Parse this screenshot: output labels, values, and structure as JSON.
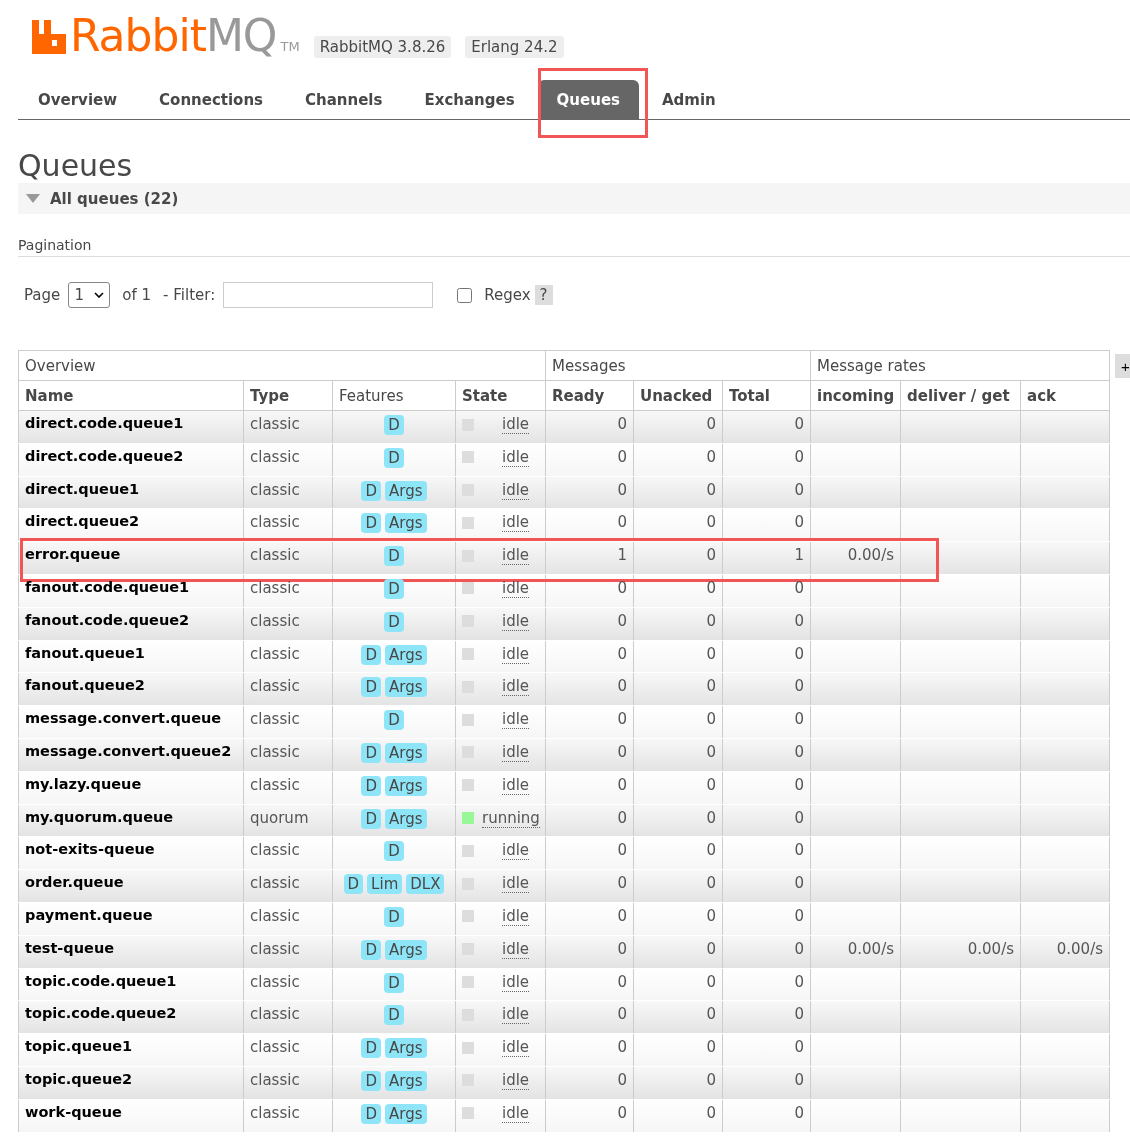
{
  "header": {
    "logo": {
      "brand": "Rabbit",
      "suffix": "MQ",
      "mark": "TM"
    },
    "versions": [
      "RabbitMQ 3.8.26",
      "Erlang 24.2"
    ]
  },
  "tabs": [
    {
      "label": "Overview",
      "selected": false,
      "highlighted": false
    },
    {
      "label": "Connections",
      "selected": false,
      "highlighted": false
    },
    {
      "label": "Channels",
      "selected": false,
      "highlighted": false
    },
    {
      "label": "Exchanges",
      "selected": false,
      "highlighted": false
    },
    {
      "label": "Queues",
      "selected": true,
      "highlighted": true
    },
    {
      "label": "Admin",
      "selected": false,
      "highlighted": false
    }
  ],
  "page_title": "Queues",
  "section": {
    "title": "All queues (22)",
    "expanded": true
  },
  "pagination": {
    "title": "Pagination",
    "page_label": "Page",
    "page": "1",
    "of": "of 1",
    "filter_label": "- Filter:",
    "regex": {
      "label": "Regex",
      "checked": false
    },
    "help": "?"
  },
  "table": {
    "groups": [
      "Overview",
      "Messages",
      "Message rates"
    ],
    "add_button": "+",
    "columns": [
      "Name",
      "Type",
      "Features",
      "State",
      "Ready",
      "Unacked",
      "Total",
      "incoming",
      "deliver / get",
      "ack"
    ],
    "rows": [
      {
        "name": "direct.code.queue1",
        "type": "classic",
        "features": [
          "D"
        ],
        "state": "idle",
        "color": "#dddddd",
        "ready": "0",
        "unacked": "0",
        "total": "0",
        "highlighted": false
      },
      {
        "name": "direct.code.queue2",
        "type": "classic",
        "features": [
          "D"
        ],
        "state": "idle",
        "color": "#dddddd",
        "ready": "0",
        "unacked": "0",
        "total": "0",
        "highlighted": false
      },
      {
        "name": "direct.queue1",
        "type": "classic",
        "features": [
          "D",
          "Args"
        ],
        "state": "idle",
        "color": "#dddddd",
        "ready": "0",
        "unacked": "0",
        "total": "0",
        "highlighted": false
      },
      {
        "name": "direct.queue2",
        "type": "classic",
        "features": [
          "D",
          "Args"
        ],
        "state": "idle",
        "color": "#dddddd",
        "ready": "0",
        "unacked": "0",
        "total": "0",
        "highlighted": false
      },
      {
        "name": "error.queue",
        "type": "classic",
        "features": [
          "D"
        ],
        "state": "idle",
        "color": "#dddddd",
        "ready": "1",
        "unacked": "0",
        "total": "1",
        "incoming": "0.00/s",
        "highlighted": true
      },
      {
        "name": "fanout.code.queue1",
        "type": "classic",
        "features": [
          "D"
        ],
        "state": "idle",
        "color": "#dddddd",
        "ready": "0",
        "unacked": "0",
        "total": "0",
        "highlighted": false
      },
      {
        "name": "fanout.code.queue2",
        "type": "classic",
        "features": [
          "D"
        ],
        "state": "idle",
        "color": "#dddddd",
        "ready": "0",
        "unacked": "0",
        "total": "0",
        "highlighted": false
      },
      {
        "name": "fanout.queue1",
        "type": "classic",
        "features": [
          "D",
          "Args"
        ],
        "state": "idle",
        "color": "#dddddd",
        "ready": "0",
        "unacked": "0",
        "total": "0",
        "highlighted": false
      },
      {
        "name": "fanout.queue2",
        "type": "classic",
        "features": [
          "D",
          "Args"
        ],
        "state": "idle",
        "color": "#dddddd",
        "ready": "0",
        "unacked": "0",
        "total": "0",
        "highlighted": false
      },
      {
        "name": "message.convert.queue",
        "type": "classic",
        "features": [
          "D"
        ],
        "state": "idle",
        "color": "#dddddd",
        "ready": "0",
        "unacked": "0",
        "total": "0",
        "highlighted": false
      },
      {
        "name": "message.convert.queue2",
        "type": "classic",
        "features": [
          "D",
          "Args"
        ],
        "state": "idle",
        "color": "#dddddd",
        "ready": "0",
        "unacked": "0",
        "total": "0",
        "highlighted": false
      },
      {
        "name": "my.lazy.queue",
        "type": "classic",
        "features": [
          "D",
          "Args"
        ],
        "state": "idle",
        "color": "#dddddd",
        "ready": "0",
        "unacked": "0",
        "total": "0",
        "highlighted": false
      },
      {
        "name": "my.quorum.queue",
        "type": "quorum",
        "features": [
          "D",
          "Args"
        ],
        "state": "running",
        "color": "#98f898",
        "ready": "0",
        "unacked": "0",
        "total": "0",
        "highlighted": false
      },
      {
        "name": "not-exits-queue",
        "type": "classic",
        "features": [
          "D"
        ],
        "state": "idle",
        "color": "#dddddd",
        "ready": "0",
        "unacked": "0",
        "total": "0",
        "highlighted": false
      },
      {
        "name": "order.queue",
        "type": "classic",
        "features": [
          "D",
          "Lim",
          "DLX"
        ],
        "state": "idle",
        "color": "#dddddd",
        "ready": "0",
        "unacked": "0",
        "total": "0",
        "highlighted": false
      },
      {
        "name": "payment.queue",
        "type": "classic",
        "features": [
          "D"
        ],
        "state": "idle",
        "color": "#dddddd",
        "ready": "0",
        "unacked": "0",
        "total": "0",
        "highlighted": false
      },
      {
        "name": "test-queue",
        "type": "classic",
        "features": [
          "D",
          "Args"
        ],
        "state": "idle",
        "color": "#dddddd",
        "ready": "0",
        "unacked": "0",
        "total": "0",
        "incoming": "0.00/s",
        "deliver_get": "0.00/s",
        "ack": "0.00/s",
        "highlighted": false
      },
      {
        "name": "topic.code.queue1",
        "type": "classic",
        "features": [
          "D"
        ],
        "state": "idle",
        "color": "#dddddd",
        "ready": "0",
        "unacked": "0",
        "total": "0",
        "highlighted": false
      },
      {
        "name": "topic.code.queue2",
        "type": "classic",
        "features": [
          "D"
        ],
        "state": "idle",
        "color": "#dddddd",
        "ready": "0",
        "unacked": "0",
        "total": "0",
        "highlighted": false
      },
      {
        "name": "topic.queue1",
        "type": "classic",
        "features": [
          "D",
          "Args"
        ],
        "state": "idle",
        "color": "#dddddd",
        "ready": "0",
        "unacked": "0",
        "total": "0",
        "highlighted": false
      },
      {
        "name": "topic.queue2",
        "type": "classic",
        "features": [
          "D",
          "Args"
        ],
        "state": "idle",
        "color": "#dddddd",
        "ready": "0",
        "unacked": "0",
        "total": "0",
        "highlighted": false
      },
      {
        "name": "work-queue",
        "type": "classic",
        "features": [
          "D",
          "Args"
        ],
        "state": "idle",
        "color": "#dddddd",
        "ready": "0",
        "unacked": "0",
        "total": "0",
        "highlighted": false
      }
    ]
  }
}
